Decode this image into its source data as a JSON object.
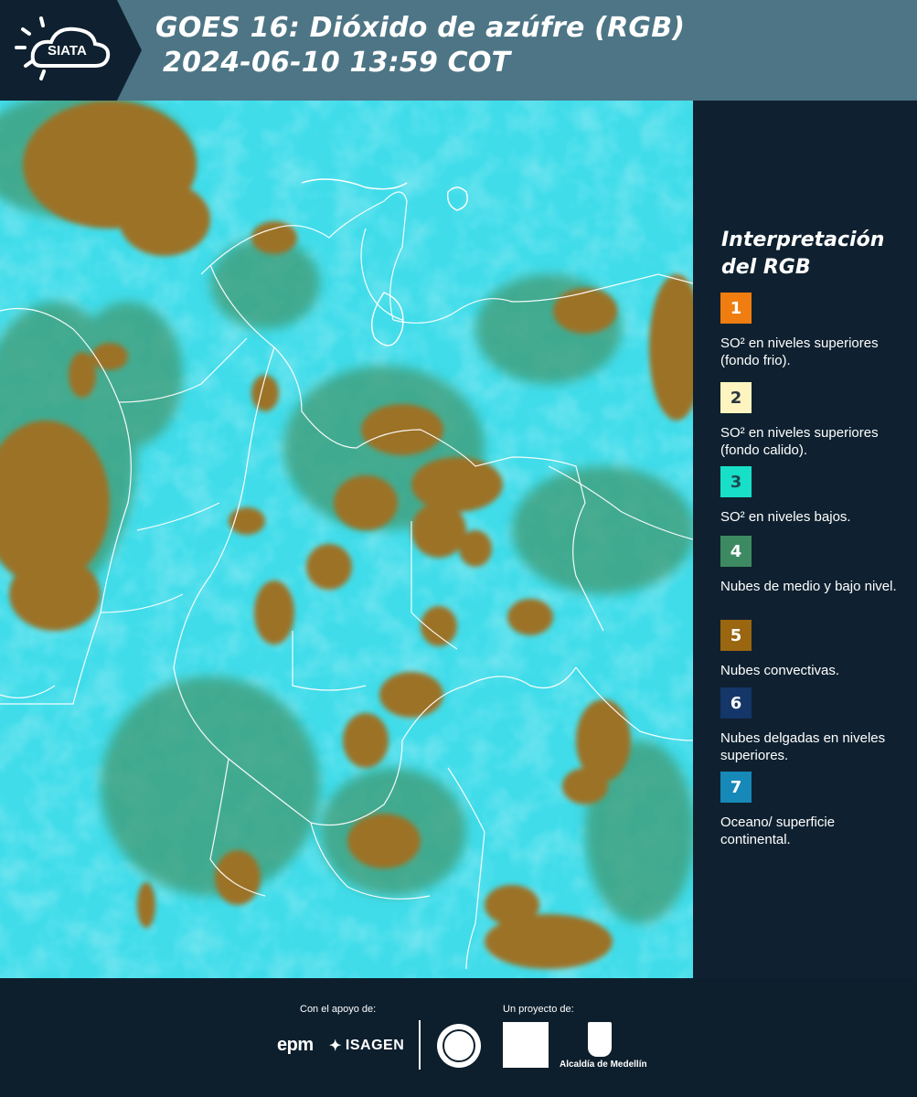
{
  "header": {
    "logo_text": "SIATA",
    "title_line1": "GOES 16: Dióxido de azúfre (RGB)",
    "title_line2": "2024-06-10 13:59 COT"
  },
  "legend": {
    "title_line1": "Interpretación",
    "title_line2": "del RGB",
    "items": [
      {
        "number": "1",
        "color": "#f07d10",
        "numcolor": "#ffffff",
        "text": "SO² en niveles superiores (fondo frio)."
      },
      {
        "number": "2",
        "color": "#fdf4c0",
        "numcolor": "#2a3540",
        "text": "SO² en niveles superiores (fondo calido)."
      },
      {
        "number": "3",
        "color": "#18e0c8",
        "numcolor": "#1e4a52",
        "text": "SO² en niveles bajos."
      },
      {
        "number": "4",
        "color": "#3d8a62",
        "numcolor": "#ffffff",
        "text": "Nubes de medio y bajo nivel."
      },
      {
        "number": "5",
        "color": "#9a6610",
        "numcolor": "#ffffff",
        "text": "Nubes convectivas."
      },
      {
        "number": "6",
        "color": "#143668",
        "numcolor": "#ffffff",
        "text": "Nubes delgadas en niveles superiores."
      },
      {
        "number": "7",
        "color": "#1689b8",
        "numcolor": "#ffffff",
        "text": "Oceano/ superficie continental."
      }
    ]
  },
  "footer": {
    "support_label": "Con el apoyo de:",
    "project_label": "Un proyecto de:",
    "epm": "epm",
    "isagen": "ISAGEN",
    "alcaldia": "Alcaldía de Medellín"
  },
  "colors": {
    "header_bg": "#4d7585",
    "panel_bg": "#0f2130",
    "map_cyan": "#3ee0ec",
    "convective": "#9a6e22",
    "mid_low": "#3d8a62"
  }
}
